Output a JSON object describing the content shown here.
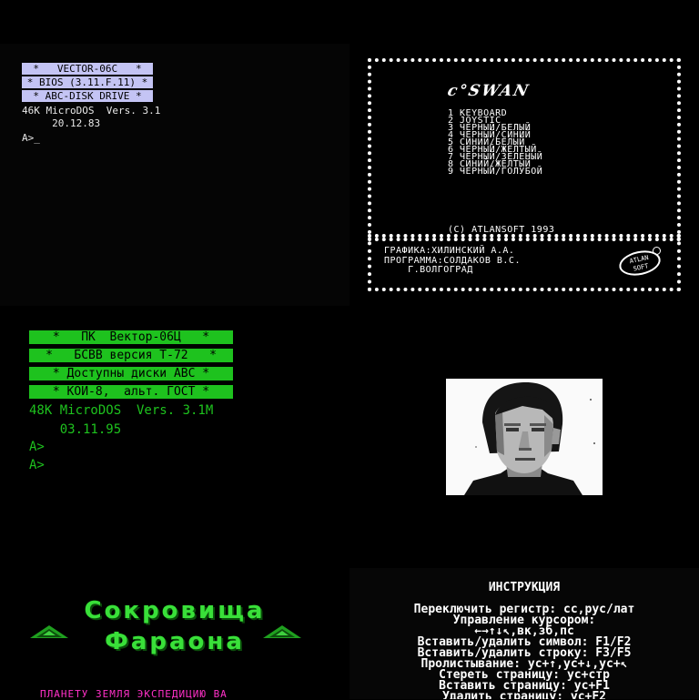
{
  "vector": {
    "bars": [
      "*   VECTOR-06C   *",
      "* BIOS (3.11.F.11) *",
      "* ABC-DISK DRIVE *"
    ],
    "lines": [
      "46K MicroDOS  Vers. 3.1",
      "     20.12.83"
    ],
    "prompt": "A>_",
    "bar_color": "#c4c4f4",
    "text_color": "#e8e8e8"
  },
  "swan": {
    "logo": "c°SWAN",
    "menu": [
      "1 KEYBOARD",
      "2 JOYSTIC",
      "3 ЧЕРНЫЙ/БЕЛЫЙ",
      "4 ЧЕРНЫЙ/СИНИЙ",
      "5 СИНИЙ/БЕЛЫЙ",
      "6 ЧЕРНЫЙ/ЖЕЛТЫЙ",
      "7 ЧЕРНЫЙ/ЗЕЛЕНЫЙ",
      "8 СИНИЙ/ЖЕЛТЫЙ",
      "9 ЧЕРНЫЙ/ГОЛУБОЙ"
    ],
    "copyright": "(C) ATLANSOFT 1993",
    "credits": [
      "ГРАФИКА:ХИЛИНСКИЙ А.А.",
      "ПРОГРАММА:СОЛДАКОВ В.С.",
      "    Г.ВОЛГОГРАД"
    ],
    "badge_line1": "ATLAN",
    "badge_line2": "SOFT"
  },
  "green": {
    "bars": [
      "*   ПК  Вектор-06Ц   *",
      "*   БСВВ версия Т-72   *",
      "* Доступны диски АВС *",
      "* КОИ-8,  альт. ГОСТ *"
    ],
    "lines": [
      "48K MicroDOS  Vers. 3.1M",
      "    03.11.95"
    ],
    "prompts": [
      "A>",
      "A>"
    ],
    "color": "#1ec21e"
  },
  "pharaoh": {
    "title1": "Сокровища",
    "title2": "Фараона",
    "ticker": "ПЛАНЕТУ ЗЕМЛЯ ЭКСПЕДИЦИЮ ВА",
    "title_color": "#39e039",
    "ticker_color": "#ff30c8"
  },
  "instr": {
    "title": "ИНСТРУКЦИЯ",
    "lines": [
      "Переключить регистр: сс,рус/лат",
      "Управление курсором:",
      "←→↑↓↖,вк,зб,пс",
      "Вставить/удалить символ: F1/F2",
      "Вставить/удалить строку: F3/F5",
      "Пролистывание: ус+↑,ус+↓,ус+↖",
      "Стереть страницу: ус+стр",
      "Вставить страницу: ус+F1",
      "Удалить страницу: ус+F2"
    ]
  }
}
